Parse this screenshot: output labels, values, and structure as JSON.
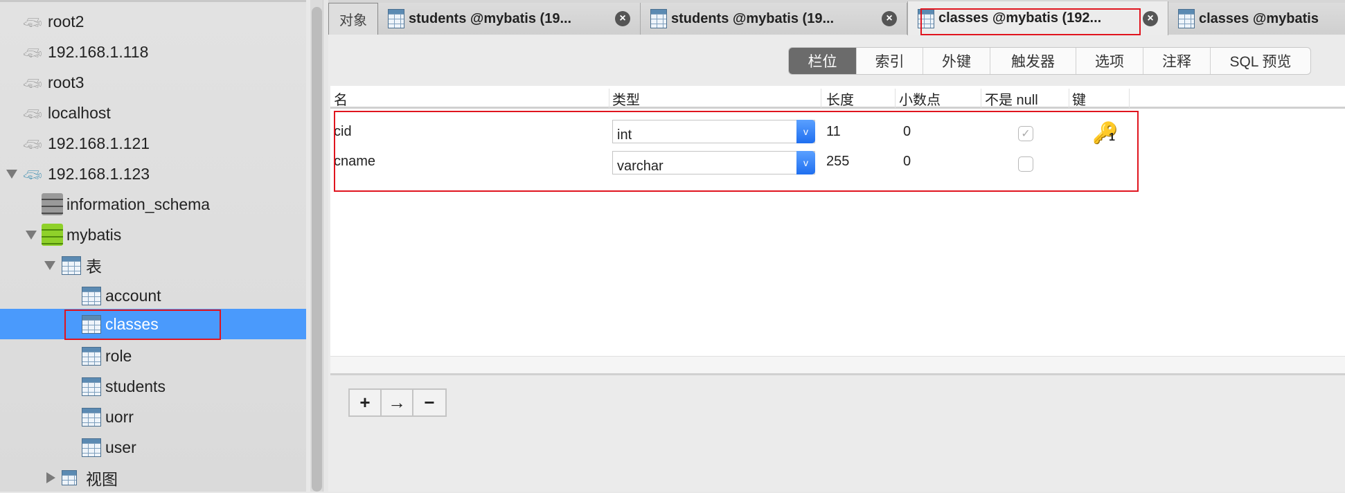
{
  "sidebar": {
    "connections": [
      "root2",
      "192.168.1.118",
      "root3",
      "localhost",
      "192.168.1.121",
      "192.168.1.123"
    ],
    "databases": [
      "information_schema",
      "mybatis"
    ],
    "tables_folder": "表",
    "tables": [
      "account",
      "classes",
      "role",
      "students",
      "uorr",
      "user"
    ],
    "views_folder": "视图",
    "selected": "classes"
  },
  "tabs": {
    "objects": "对象",
    "items": [
      {
        "label": "students @mybatis (19..."
      },
      {
        "label": "students @mybatis (19..."
      },
      {
        "label": "classes @mybatis (192..."
      },
      {
        "label": "classes @mybatis"
      }
    ],
    "close": "×"
  },
  "segments": [
    "栏位",
    "索引",
    "外键",
    "触发器",
    "选项",
    "注释",
    "SQL 预览"
  ],
  "grid": {
    "headers": [
      "名",
      "类型",
      "长度",
      "小数点",
      "不是 null",
      "键"
    ],
    "rows": [
      {
        "name": "cid",
        "type": "int",
        "length": "11",
        "decimals": "0",
        "not_null": true,
        "key": "1"
      },
      {
        "name": "cname",
        "type": "varchar",
        "length": "255",
        "decimals": "0",
        "not_null": false,
        "key": ""
      }
    ],
    "check": "✓",
    "chevron": "v"
  },
  "bottom_buttons": [
    "+",
    "→",
    "−"
  ],
  "colors": {
    "selection": "#4a9afc",
    "annotation": "#e0141e",
    "select_button": "#1f6ff0"
  }
}
